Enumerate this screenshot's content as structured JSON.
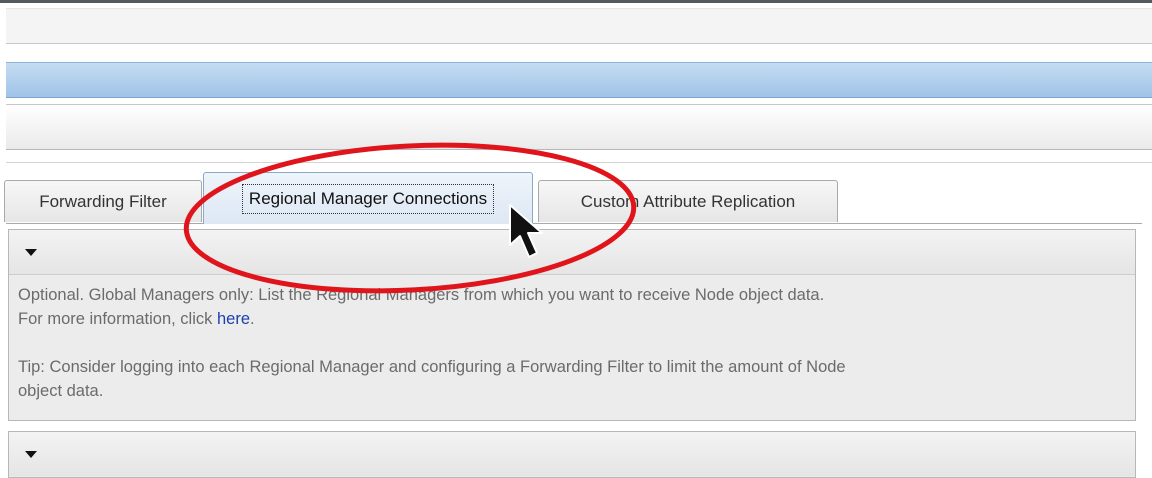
{
  "tabs": [
    {
      "label": "Forwarding Filter",
      "selected": false
    },
    {
      "label": "Regional Manager Connections",
      "selected": true
    },
    {
      "label": "Custom Attribute Replication",
      "selected": false
    }
  ],
  "panel": {
    "line1": "Optional. Global Managers only: List the Regional Managers from which you want to receive Node object data.",
    "line2_prefix": "For more information, click ",
    "line2_link": "here",
    "line2_suffix": ".",
    "tip_line1": "Tip: Consider logging into each Regional Manager and configuring a Forwarding Filter to limit the amount of Node",
    "tip_line2": "object data."
  },
  "colors": {
    "title_bar": "#9fc3e8",
    "link": "#1f3fae",
    "annotation_ellipse": "#e0151b"
  },
  "icons": {
    "collapse_caret": "chevron-down-icon",
    "cursor": "mouse-pointer-icon"
  }
}
